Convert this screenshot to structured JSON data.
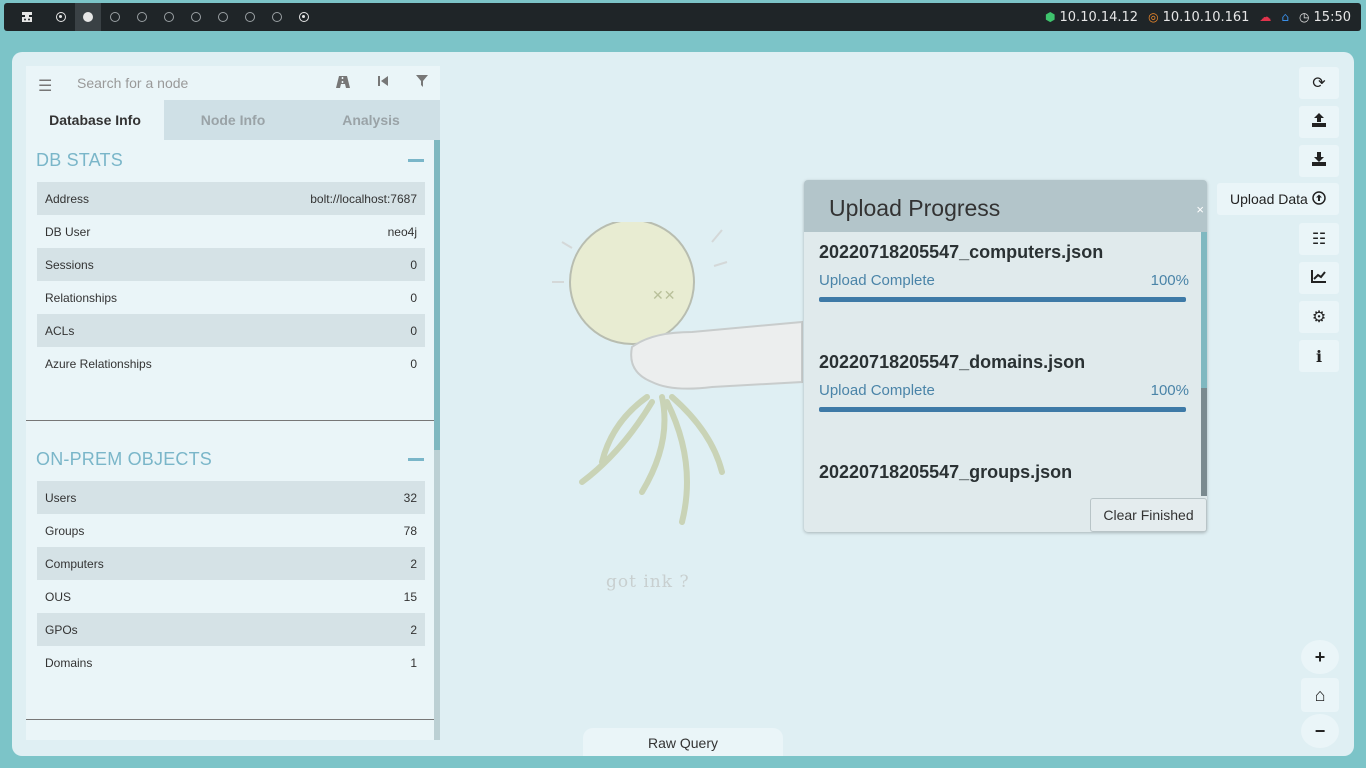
{
  "topbar": {
    "workspaces": [
      {
        "state": "ring"
      },
      {
        "state": "filled",
        "active": true
      },
      {
        "state": "empty"
      },
      {
        "state": "empty"
      },
      {
        "state": "empty"
      },
      {
        "state": "empty"
      },
      {
        "state": "empty"
      },
      {
        "state": "empty"
      },
      {
        "state": "empty"
      },
      {
        "state": "ring"
      }
    ],
    "vpn_ip": "10.10.14.12",
    "target_ip": "10.10.10.161",
    "clock": "15:50",
    "colors": {
      "vpn": "#3ec46d",
      "target": "#f08a2b",
      "cloud": "#e0334c",
      "home": "#3a8ee6"
    }
  },
  "sidebar": {
    "search_placeholder": "Search for a node",
    "tabs": [
      "Database Info",
      "Node Info",
      "Analysis"
    ],
    "db_stats": {
      "title": "DB STATS",
      "rows": [
        {
          "label": "Address",
          "value": "bolt://localhost:7687"
        },
        {
          "label": "DB User",
          "value": "neo4j"
        },
        {
          "label": "Sessions",
          "value": "0"
        },
        {
          "label": "Relationships",
          "value": "0"
        },
        {
          "label": "ACLs",
          "value": "0"
        },
        {
          "label": "Azure Relationships",
          "value": "0"
        }
      ]
    },
    "onprem": {
      "title": "ON-PREM OBJECTS",
      "rows": [
        {
          "label": "Users",
          "value": "32"
        },
        {
          "label": "Groups",
          "value": "78"
        },
        {
          "label": "Computers",
          "value": "2"
        },
        {
          "label": "OUS",
          "value": "15"
        },
        {
          "label": "GPOs",
          "value": "2"
        },
        {
          "label": "Domains",
          "value": "1"
        }
      ]
    }
  },
  "art": {
    "caption": "got ink ?"
  },
  "toolbar": {
    "upload_tooltip": "Upload Data",
    "icons": [
      "refresh-icon",
      "upload-icon",
      "download-icon",
      "upload-data-icon",
      "tasks-icon",
      "chart-icon",
      "settings-icon",
      "info-icon"
    ]
  },
  "modal": {
    "title": "Upload Progress",
    "close": "×",
    "items": [
      {
        "file": "20220718205547_computers.json",
        "status": "Upload Complete",
        "percent": "100%",
        "progress": 1.0
      },
      {
        "file": "20220718205547_domains.json",
        "status": "Upload Complete",
        "percent": "100%",
        "progress": 1.0
      },
      {
        "file": "20220718205547_groups.json",
        "status": "",
        "percent": "",
        "progress": null
      }
    ],
    "clear_label": "Clear Finished"
  },
  "raw_query": "Raw Query"
}
